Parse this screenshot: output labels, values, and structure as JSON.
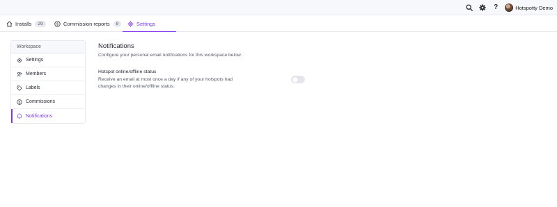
{
  "topbar": {
    "user_name": "Hotspotty Demo",
    "help_label": "?",
    "icons": [
      "search-icon",
      "gear-icon",
      "help-icon"
    ]
  },
  "tabs": [
    {
      "label": "Installs",
      "badge": "29",
      "icon": "home-icon"
    },
    {
      "label": "Commission reports",
      "badge": "8",
      "icon": "dollar-icon"
    },
    {
      "label": "Settings",
      "icon": "gear-icon",
      "active": true
    }
  ],
  "sidebar": {
    "header": "Workspace",
    "items": [
      {
        "label": "Settings",
        "icon": "gear-icon"
      },
      {
        "label": "Members",
        "icon": "users-icon"
      },
      {
        "label": "Labels",
        "icon": "tag-icon"
      },
      {
        "label": "Commissions",
        "icon": "dollar-icon"
      },
      {
        "label": "Notifications",
        "icon": "bell-icon",
        "active": true
      }
    ]
  },
  "main": {
    "title": "Notifications",
    "description": "Configure your personal email notifications for this workspace below.",
    "setting": {
      "title": "Hotspot online/offline status",
      "description": "Receive an email at most once a day if any of your hotspots had changes in their online/offline status.",
      "enabled": false
    }
  },
  "colors": {
    "accent": "#7c3aed",
    "border": "#e6e8ee",
    "topbar_bg": "#f7f8fb",
    "toggle_off": "#e4e6eb"
  }
}
